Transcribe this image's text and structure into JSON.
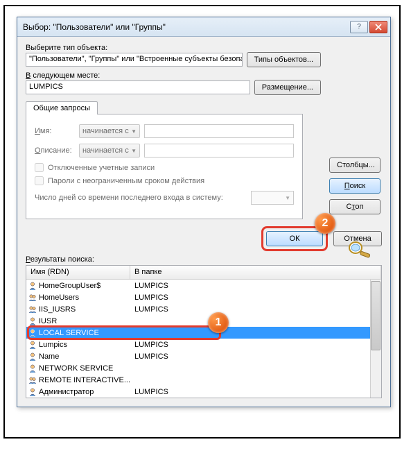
{
  "window": {
    "title": "Выбор: \"Пользователи\" или \"Группы\""
  },
  "section1": {
    "label": "Выберите тип объекта:",
    "value": "\"Пользователи\", \"Группы\" или \"Встроенные субъекты безопасности\"",
    "button": "Типы объектов..."
  },
  "section2": {
    "label_pre": "В",
    "label_post": " следующем месте:",
    "value": "LUMPICS",
    "button": "Размещение..."
  },
  "tab": {
    "label": "Общие запросы",
    "name_label": "Имя:",
    "name_combo": "начинается с",
    "desc_label": "Описание:",
    "desc_combo": "начинается с",
    "chk1": "Отключенные учетные записи",
    "chk2": "Пароли с неограниченным сроком действия",
    "days_label": "Число дней со времени последнего входа в систему:"
  },
  "side": {
    "columns": "Столбцы...",
    "find": "Поиск",
    "stop": "Стоп"
  },
  "actions": {
    "ok": "ОК",
    "cancel": "Отмена"
  },
  "results": {
    "label_pre": "Р",
    "label_post": "езультаты поиска:",
    "col_name": "Имя (RDN)",
    "col_folder": "В папке",
    "rows": [
      {
        "name": "HomeGroupUser$",
        "folder": "LUMPICS",
        "kind": "user"
      },
      {
        "name": "HomeUsers",
        "folder": "LUMPICS",
        "kind": "group"
      },
      {
        "name": "IIS_IUSRS",
        "folder": "LUMPICS",
        "kind": "group"
      },
      {
        "name": "IUSR",
        "folder": "",
        "kind": "user"
      },
      {
        "name": "LOCAL SERVICE",
        "folder": "",
        "kind": "user",
        "selected": true
      },
      {
        "name": "Lumpics",
        "folder": "LUMPICS",
        "kind": "user"
      },
      {
        "name": "Name",
        "folder": "LUMPICS",
        "kind": "user"
      },
      {
        "name": "NETWORK SERVICE",
        "folder": "",
        "kind": "user"
      },
      {
        "name": "REMOTE INTERACTIVE...",
        "folder": "",
        "kind": "group"
      },
      {
        "name": "Администратор",
        "folder": "LUMPICS",
        "kind": "user"
      }
    ]
  },
  "badges": {
    "one": "1",
    "two": "2"
  }
}
